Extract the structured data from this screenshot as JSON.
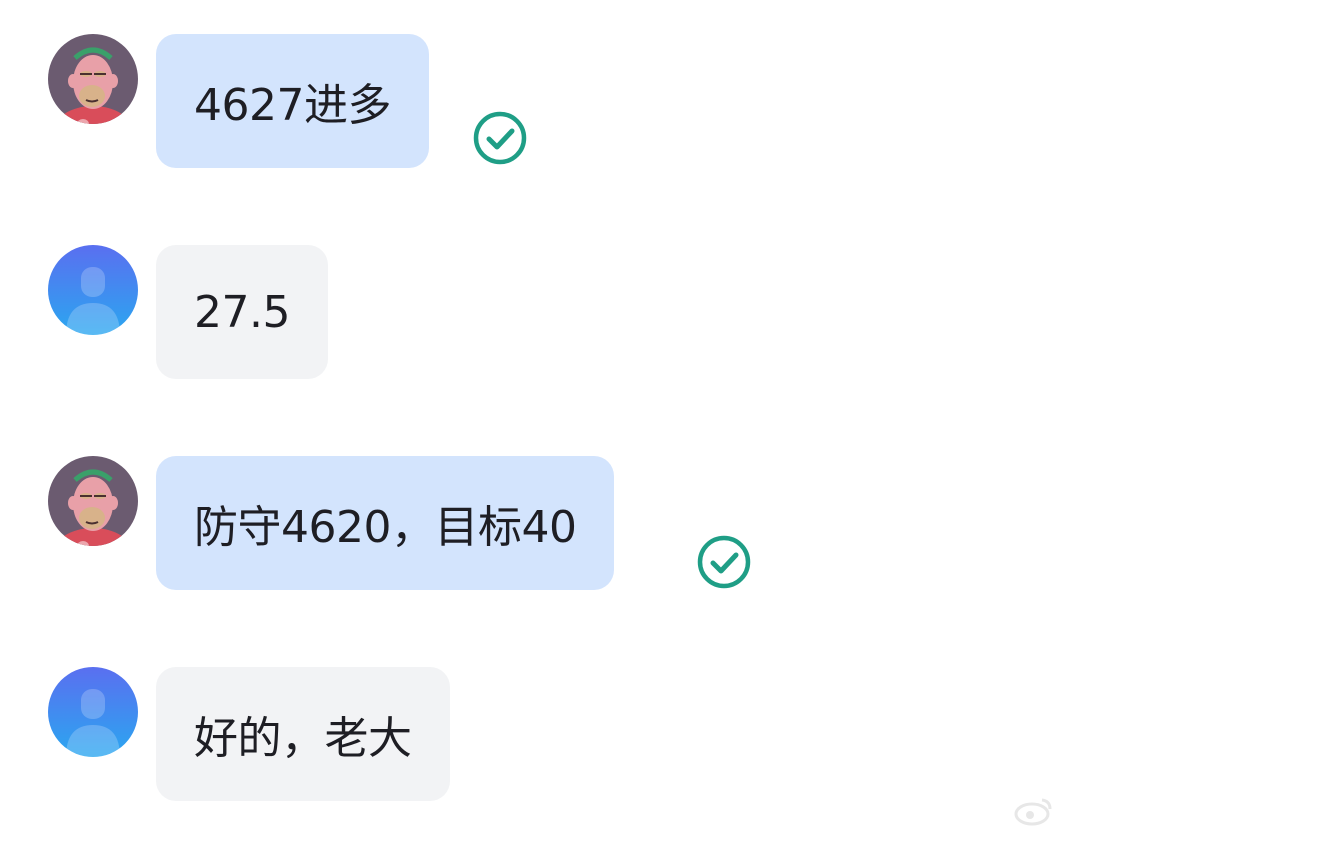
{
  "messages": [
    {
      "sender": "me",
      "avatar": "ape-avatar",
      "text": "4627进多",
      "status": "read",
      "status_icon": "check-circle-icon"
    },
    {
      "sender": "other",
      "avatar": "default-user-avatar",
      "text": "27.5"
    },
    {
      "sender": "me",
      "avatar": "ape-avatar",
      "text": "防守4620，目标40",
      "status": "read",
      "status_icon": "check-circle-icon"
    },
    {
      "sender": "other",
      "avatar": "default-user-avatar",
      "text": "好的，老大"
    }
  ],
  "colors": {
    "my_bubble": "#d3e4fd",
    "other_bubble": "#f2f3f5",
    "read_check": "#1f9e86",
    "default_avatar_top": "#5a6ff0",
    "default_avatar_bottom": "#2aa7f0"
  },
  "watermark": {
    "icon": "weibo-logo-icon",
    "text": ""
  }
}
